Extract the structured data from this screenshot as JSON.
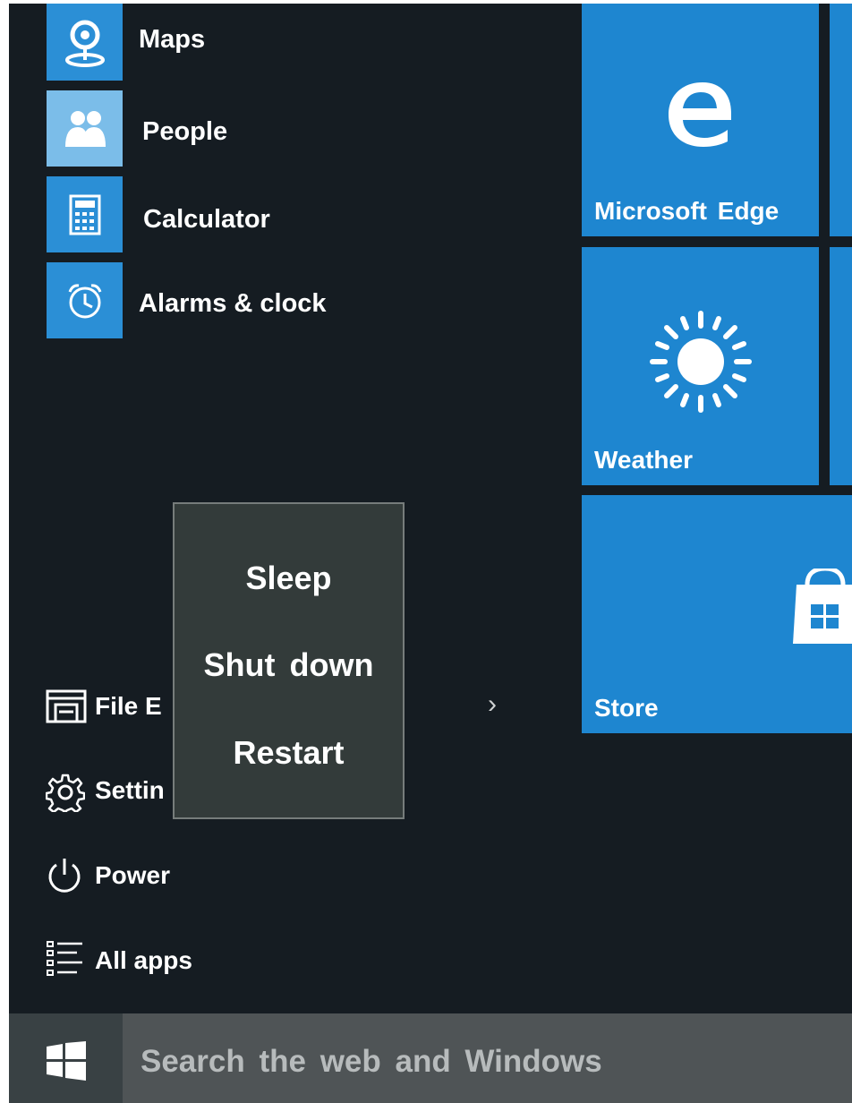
{
  "apps": [
    {
      "label": "Maps",
      "icon": "maps-icon"
    },
    {
      "label": "People",
      "icon": "people-icon"
    },
    {
      "label": "Calculator",
      "icon": "calculator-icon"
    },
    {
      "label": "Alarms & clock",
      "icon": "alarm-clock-icon"
    }
  ],
  "menu": {
    "file_explorer": "File E",
    "settings": "Settin",
    "power": "Power",
    "all_apps": "All apps"
  },
  "power_menu": {
    "sleep": "Sleep",
    "shut_down": "Shut down",
    "restart": "Restart"
  },
  "tiles": {
    "edge": "Microsoft Edge",
    "weather": "Weather",
    "store": "Store"
  },
  "taskbar": {
    "search_placeholder": "Search the web and Windows"
  },
  "colors": {
    "tile_blue": "#1e86d0",
    "app_tile_blue": "#2b8fd6",
    "start_background": "#151c22",
    "taskbar": "#4f5456",
    "flyout": "#333b3a"
  }
}
